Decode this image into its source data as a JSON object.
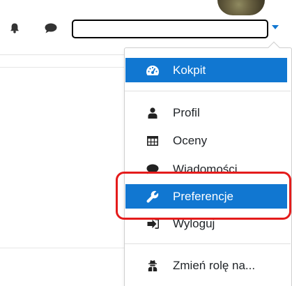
{
  "header": {
    "notifications_icon": "bell-icon",
    "messages_icon": "chat-bubble-icon",
    "user_name": "",
    "accent_color": "#1177d1"
  },
  "user_menu": {
    "items": [
      {
        "label": "Kokpit",
        "icon": "dashboard-gauge-icon",
        "active": true
      },
      {
        "label": "Profil",
        "icon": "user-icon",
        "active": false
      },
      {
        "label": "Oceny",
        "icon": "table-icon",
        "active": false
      },
      {
        "label": "Wiadomości",
        "icon": "comment-icon",
        "active": false
      },
      {
        "label": "Preferencje",
        "icon": "wrench-icon",
        "active": true
      },
      {
        "label": "Wyloguj",
        "icon": "sign-out-icon",
        "active": false
      },
      {
        "label": "Zmień rolę na...",
        "icon": "user-secret-icon",
        "active": false
      }
    ]
  },
  "annotation": {
    "highlight_color": "#e41b1b"
  }
}
